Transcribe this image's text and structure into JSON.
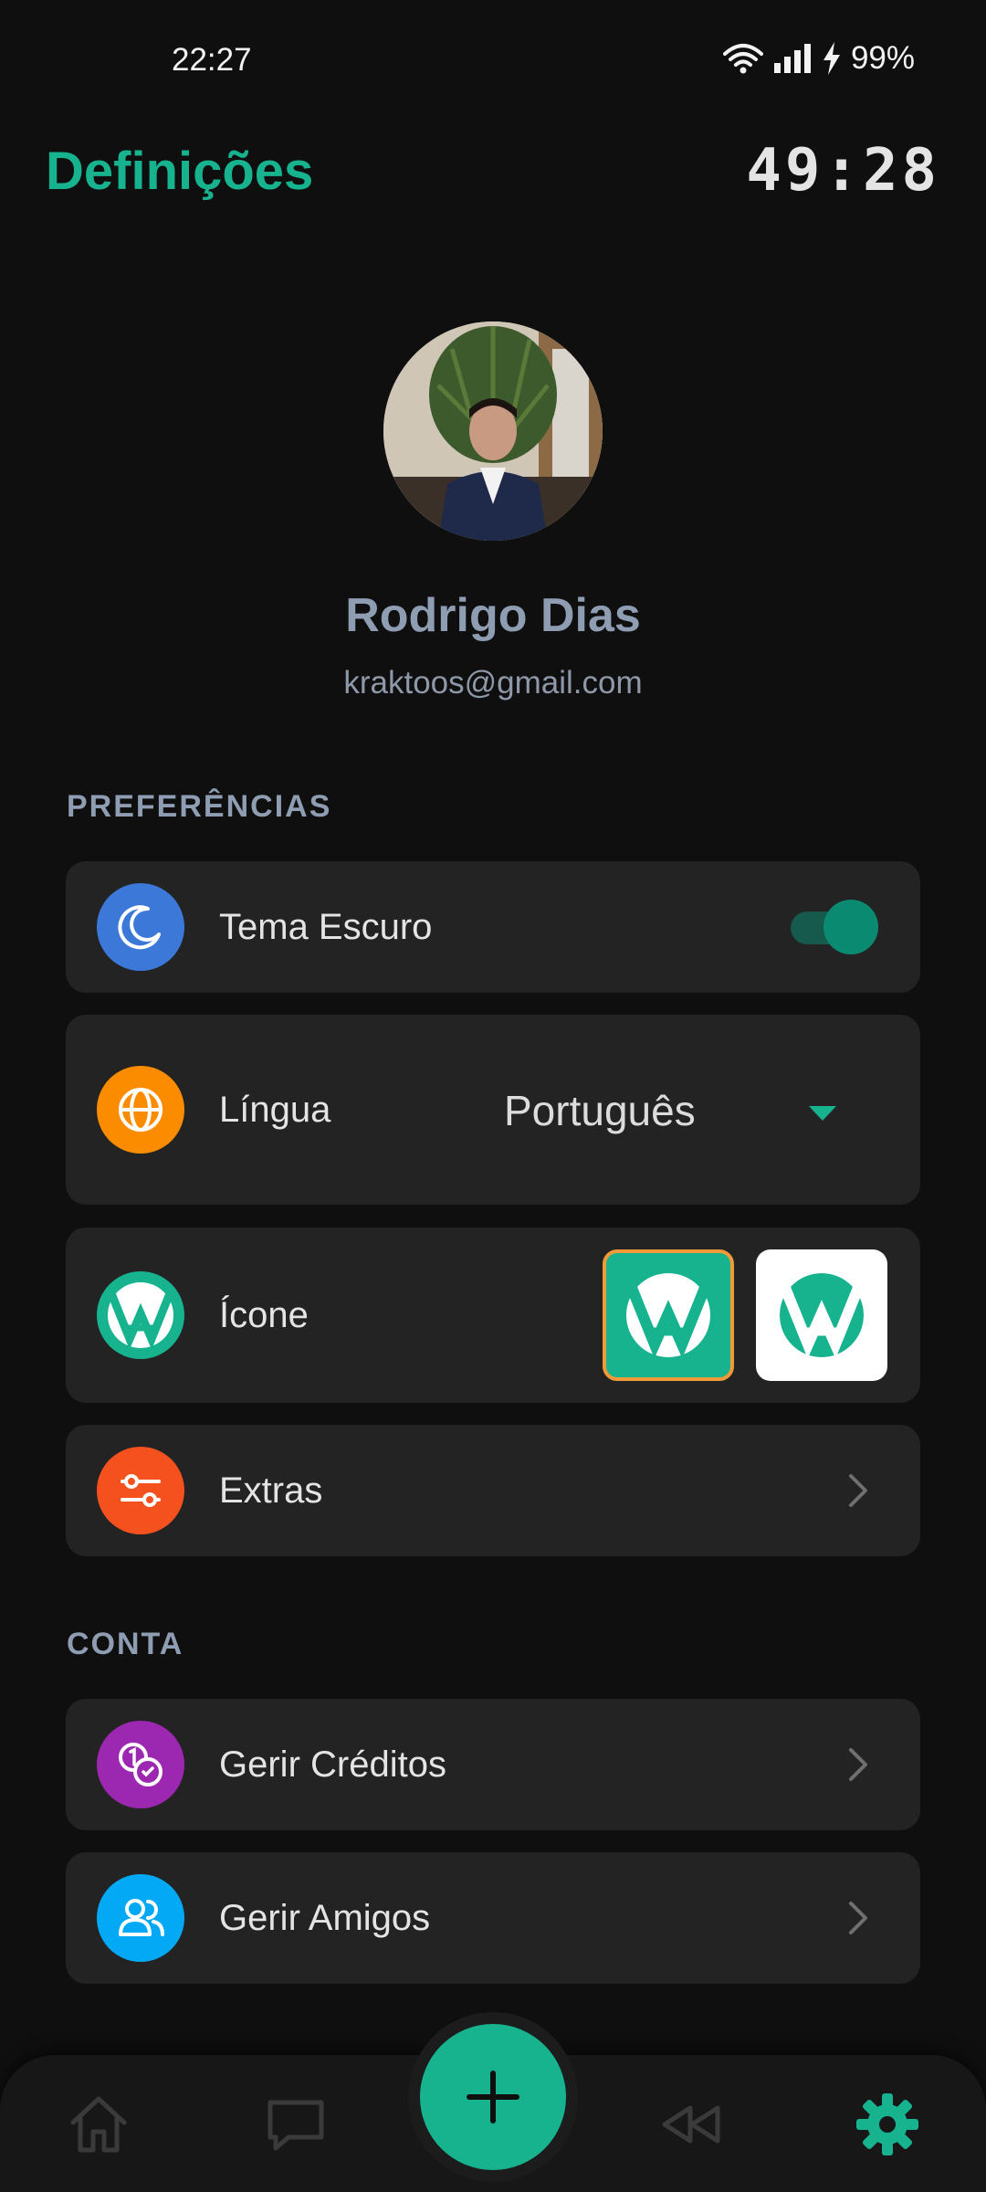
{
  "status_bar": {
    "time": "22:27",
    "battery": "99%"
  },
  "header": {
    "title": "Definições",
    "timer": "49:28"
  },
  "profile": {
    "name": "Rodrigo Dias",
    "email": "kraktoos@gmail.com"
  },
  "sections": {
    "preferences": "PREFERÊNCIAS",
    "account": "CONTA"
  },
  "preferences": {
    "dark_theme": {
      "label": "Tema Escuro",
      "enabled": true,
      "icon": "moon-icon",
      "icon_color": "#3b78d8"
    },
    "language": {
      "label": "Língua",
      "value": "Português",
      "icon": "globe-icon",
      "icon_color": "#fb8c00"
    },
    "app_icon": {
      "label": "Ícone",
      "icon": "app-logo-icon",
      "icon_color": "#17b38f",
      "options": [
        "green",
        "white"
      ],
      "selected": "green"
    },
    "extras": {
      "label": "Extras",
      "icon": "sliders-icon",
      "icon_color": "#f4511e"
    }
  },
  "account": {
    "credits": {
      "label": "Gerir Créditos",
      "icon": "coins-icon",
      "icon_color": "#9c27b0"
    },
    "friends": {
      "label": "Gerir Amigos",
      "icon": "users-icon",
      "icon_color": "#03a9f4"
    }
  },
  "bottom_nav": {
    "items": [
      "home-icon",
      "chat-icon",
      "rewind-icon",
      "settings-icon"
    ],
    "active": "settings-icon",
    "fab_icon": "plus-icon",
    "accent": "#17b38f"
  }
}
